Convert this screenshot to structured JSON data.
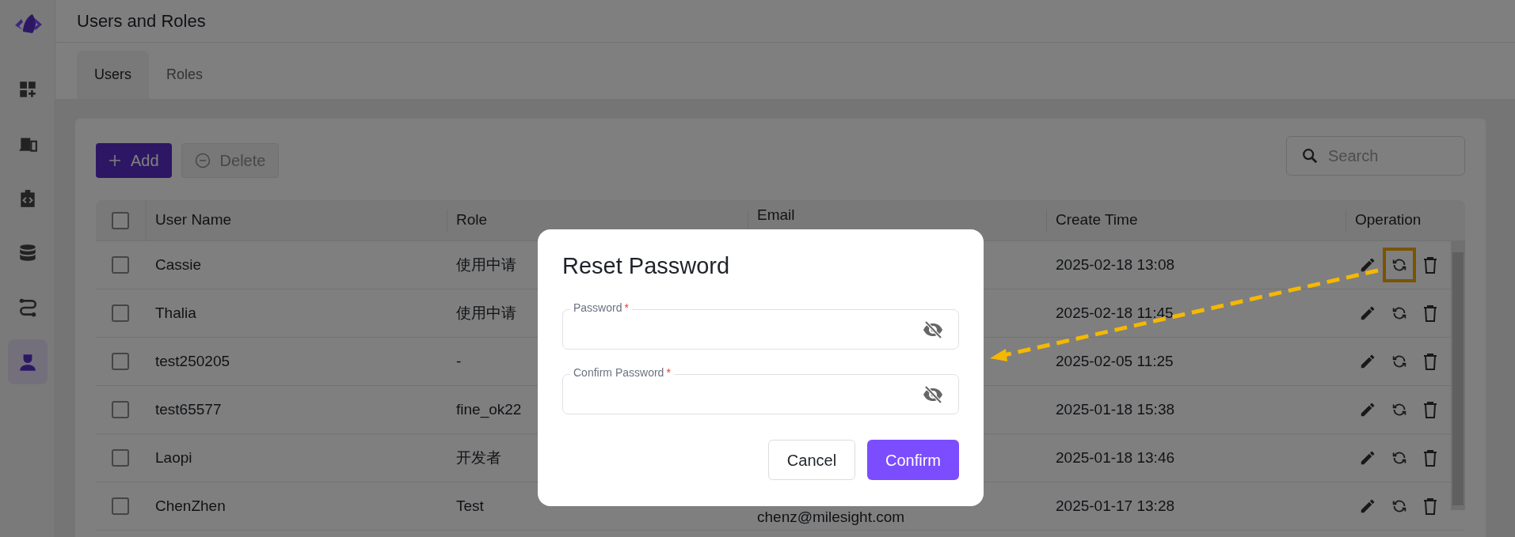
{
  "sidebar": {
    "items": [
      {
        "selected": false
      },
      {
        "selected": false
      },
      {
        "selected": false
      },
      {
        "selected": false
      },
      {
        "selected": false
      },
      {
        "selected": true
      }
    ]
  },
  "page_title": "Users and Roles",
  "tabs": [
    {
      "label": "Users",
      "selected": true
    },
    {
      "label": "Roles",
      "selected": false
    }
  ],
  "toolbar": {
    "add_button": {
      "label": "Add",
      "disabled": false
    },
    "delete_button": {
      "label": "Delete",
      "disabled": true
    },
    "search": {
      "placeholder": "Search"
    }
  },
  "table": {
    "select_all": {
      "checked": false
    },
    "columns": [
      "User Name",
      "Role",
      "Email",
      "Create Time",
      "Operation"
    ],
    "rows": [
      {
        "checked": false,
        "user_name": "Cassie",
        "role": "使用中请",
        "create_time": "2025-02-18 13:08",
        "highlighted_action": true
      },
      {
        "checked": false,
        "user_name": "Thalia",
        "role": "使用中请",
        "create_time": "2025-02-18 11:45",
        "highlighted_action": false
      },
      {
        "checked": false,
        "user_name": "test250205",
        "role": "-",
        "create_time": "2025-02-05 11:25",
        "highlighted_action": false
      },
      {
        "checked": false,
        "user_name": "test65577",
        "role": "fine_ok22",
        "create_time": "2025-01-18 15:38",
        "highlighted_action": false
      },
      {
        "checked": false,
        "user_name": "Laopi",
        "role": "开发者",
        "create_time": "2025-01-18 13:46",
        "highlighted_action": false
      },
      {
        "checked": false,
        "user_name": "ChenZhen",
        "role": "Test",
        "email": "chenz@milesight.com",
        "create_time": "2025-01-17 13:28",
        "highlighted_action": false
      }
    ]
  },
  "dialog": {
    "title": "Reset Password",
    "fields": [
      {
        "label": "Password",
        "required_mark": "*"
      },
      {
        "label": "Confirm Password",
        "required_mark": "*"
      }
    ],
    "cancel_button": "Cancel",
    "confirm_button": "Confirm"
  }
}
